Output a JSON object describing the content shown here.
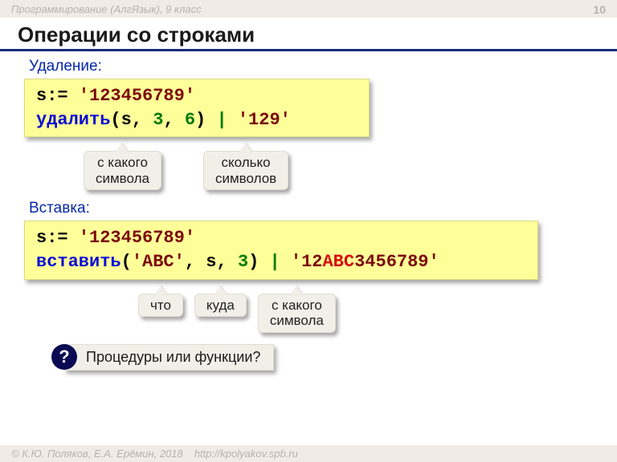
{
  "header": {
    "course": "Программирование (АлгЯзык), 9 класс",
    "page_number": "10"
  },
  "title": "Операции со строками",
  "deletion": {
    "label": "Удаление:",
    "code": {
      "line1": {
        "var": "s",
        "assign": ":= ",
        "str": "'123456789'"
      },
      "line2": {
        "fn": "удалить",
        "paren_open": "(",
        "arg0": "s",
        "comma1": ", ",
        "arg1": "3",
        "comma2": ", ",
        "arg2": "6",
        "paren_close": ") ",
        "pipe": "| ",
        "result": "'129'"
      }
    },
    "balloons": {
      "from": "с какого\nсимвола",
      "count": "сколько\nсимволов"
    }
  },
  "insertion": {
    "label": "Вставка:",
    "code": {
      "line1": {
        "var": "s",
        "assign": ":= ",
        "str": "'123456789'"
      },
      "line2": {
        "fn": "вставить",
        "paren_open": "(",
        "arg0": "'ABC'",
        "comma1": ", ",
        "arg1": "s",
        "comma2": ", ",
        "arg2": "3",
        "paren_close": ") ",
        "pipe": "| ",
        "res_a": "'12",
        "res_b": "ABC",
        "res_c": "3456789'"
      }
    },
    "balloons": {
      "what": "что",
      "where": "куда",
      "from": "с какого\nсимвола"
    }
  },
  "question": {
    "mark": "?",
    "text": "Процедуры или функции?"
  },
  "footer": {
    "copyright": "© К.Ю. Поляков, Е.А. Ерёмин, 2018",
    "url": "http://kpolyakov.spb.ru"
  }
}
